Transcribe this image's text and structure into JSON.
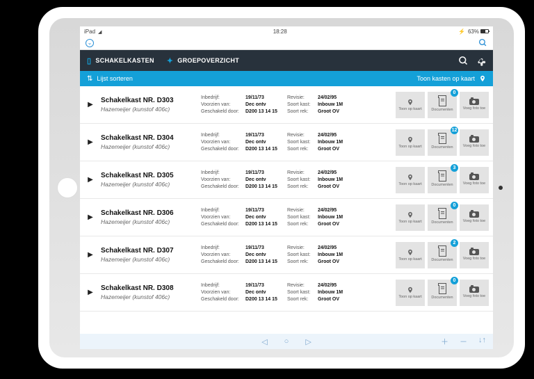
{
  "status": {
    "device": "iPad",
    "time": "18:28",
    "battery": "63%"
  },
  "nav": {
    "tab1": "SCHAKELKASTEN",
    "tab2": "GROEPOVERZICHT"
  },
  "sort": {
    "label": "Lijst sorteren",
    "map": "Toon kasten op kaart"
  },
  "labels": {
    "inbedrijf": "Inbedrijf:",
    "voorzien": "Voorzien van:",
    "geschakeld": "Geschakeld door:",
    "revisie": "Revisie:",
    "soortkast": "Soort kast:",
    "soortrek": "Soort rek:",
    "toonkaart": "Toon op kaart",
    "documenten": "Documenten",
    "voegfoto": "Voeg foto toe"
  },
  "values": {
    "inbedrijf": "19/11/73",
    "voorzien": "Dec ontv",
    "geschakeld": "D200 13 14 15",
    "revisie": "24/02/95",
    "soortkast": "Inbouw 1M",
    "soortrek": "Groot OV",
    "subtitle": "Hazemeijer (kunstof 406c)"
  },
  "rows": [
    {
      "title": "Schakelkast NR. D303",
      "docs": "0"
    },
    {
      "title": "Schakelkast NR. D304",
      "docs": "12"
    },
    {
      "title": "Schakelkast NR. D305",
      "docs": "3"
    },
    {
      "title": "Schakelkast NR. D306",
      "docs": "0"
    },
    {
      "title": "Schakelkast NR. D307",
      "docs": "2"
    },
    {
      "title": "Schakelkast NR. D308",
      "docs": "0"
    }
  ]
}
